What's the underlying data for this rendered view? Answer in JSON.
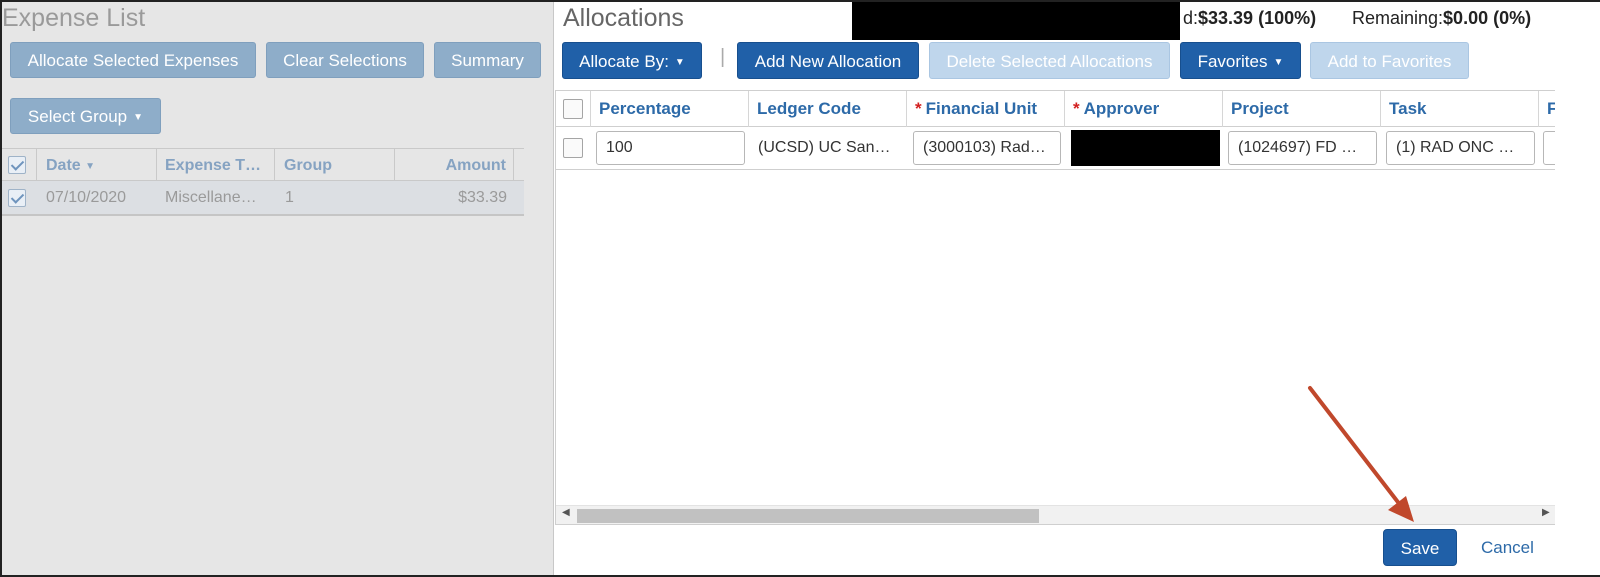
{
  "expense_list": {
    "title": "Expense List",
    "buttons": {
      "allocate_selected": "Allocate Selected Expenses",
      "clear_selections": "Clear Selections",
      "summary": "Summary",
      "select_group": "Select Group",
      "select_group_caret": "▼"
    },
    "columns": {
      "date": "Date",
      "date_sort": "▼",
      "expense_type": "Expense T…",
      "group": "Group",
      "amount": "Amount"
    },
    "rows": [
      {
        "date": "07/10/2020",
        "expense_type": "Miscellane…",
        "group": "1",
        "amount": "$33.39",
        "checked": true
      }
    ]
  },
  "allocations": {
    "title": "Allocations",
    "totals": {
      "allocated_label": "d:",
      "allocated_value": "$33.39 (100%)",
      "remaining_label": "Remaining:",
      "remaining_value": "$0.00 (0%)"
    },
    "toolbar": {
      "allocate_by": "Allocate By:",
      "separator": "|",
      "add_new": "Add New Allocation",
      "delete_selected": "Delete Selected Allocations",
      "favorites": "Favorites",
      "add_to_favorites": "Add to Favorites",
      "caret": "▼"
    },
    "columns": {
      "percentage": "Percentage",
      "ledger_code": "Ledger Code",
      "financial_unit": "Financial Unit",
      "approver": "Approver",
      "project": "Project",
      "task": "Task",
      "next": "F",
      "required_mark": "*"
    },
    "rows": [
      {
        "percentage": "100",
        "ledger_code": "(UCSD) UC San…",
        "financial_unit": "(3000103) Rad…",
        "project": "(1024697) FD …",
        "task": "(1) RAD ONC …"
      }
    ],
    "scroll": {
      "left_arrow": "◀",
      "right_arrow": "▶"
    },
    "actions": {
      "save": "Save",
      "cancel": "Cancel"
    }
  },
  "colors": {
    "primary_button": "#2060a8",
    "disabled_button": "#bfd6ec",
    "header_text": "#2d6aa8",
    "required": "#d21f1f",
    "annotation_arrow": "#c0482c"
  }
}
